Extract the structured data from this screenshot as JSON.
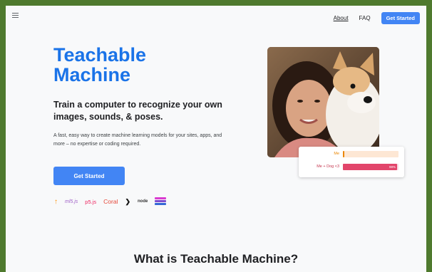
{
  "header": {
    "nav_links": [
      "About",
      "FAQ"
    ],
    "cta_label": "Get Started"
  },
  "hero": {
    "title": "Teachable Machine",
    "subtitle": "Train a computer to recognize your own images, sounds, & poses.",
    "description": "A fast, easy way to create machine learning models for your sites, apps, and more – no expertise or coding required.",
    "cta_label": "Get Started"
  },
  "logos": {
    "tensorflow_icon": "↑",
    "ml5": "ml5.js",
    "p5": "p5.js",
    "coral": "Coral",
    "framer_icon": "❯",
    "node": "node",
    "glitch_icon": "stack-icon"
  },
  "results": [
    {
      "label": "Me",
      "percent": 2,
      "color": "#ea8600",
      "track": "#fde7d4"
    },
    {
      "label": "Me + Dog <3",
      "percent": 98,
      "color": "#e2456b",
      "track": "#f9dbe3",
      "percent_label": "98%"
    }
  ],
  "section": {
    "title": "What is Teachable Machine?"
  },
  "colors": {
    "accent": "#4285f4",
    "title_blue": "#1a73e8",
    "frame_green": "#4f7a2e"
  }
}
